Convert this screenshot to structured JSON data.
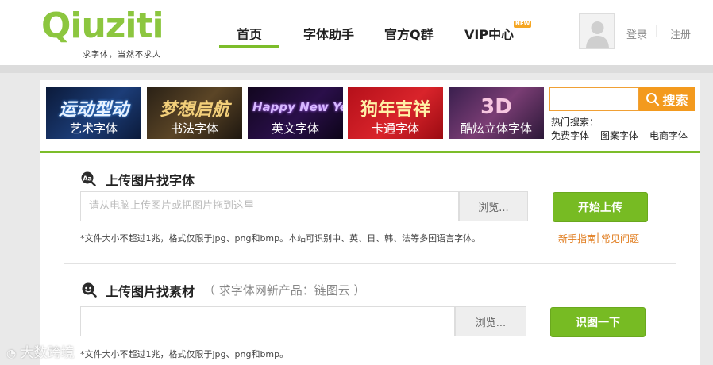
{
  "logo": {
    "text": "Qiuziti",
    "slogan": "求字体，当然不求人"
  },
  "nav": [
    {
      "label": "首页",
      "active": true
    },
    {
      "label": "字体助手"
    },
    {
      "label": "官方Q群"
    },
    {
      "label": "VIP中心",
      "badge": "NEW"
    }
  ],
  "auth": {
    "login": "登录",
    "separator": "|",
    "register": "注册"
  },
  "categories": [
    {
      "art": "运动型动",
      "label": "艺术字体"
    },
    {
      "art": "梦想启航",
      "label": "书法字体"
    },
    {
      "art": "Happy New Year",
      "label": "英文字体"
    },
    {
      "art": "狗年吉祥",
      "label": "卡通字体"
    },
    {
      "art": "3D",
      "label": "酷炫立体字体"
    }
  ],
  "search": {
    "value": "",
    "button_label": "搜索",
    "hot_title": "热门搜索：",
    "hot_links": [
      "免费字体",
      "图案字体",
      "电商字体"
    ]
  },
  "upload_font": {
    "title": "上传图片找字体",
    "placeholder": "请从电脑上传图片或把图片拖到这里",
    "browse_label": "浏览...",
    "button_label": "开始上传",
    "note": "*文件大小不超过1兆，格式仅限于jpg、png和bmp。本站可识别中、英、日、韩、法等多国语言字体。",
    "help_links": [
      "新手指南",
      "|",
      "常见问题"
    ]
  },
  "upload_material": {
    "title": "上传图片找素材",
    "subtitle": "（ 求字体网新产品：链图云 ）",
    "placeholder": "",
    "browse_label": "浏览...",
    "button_label": "识图一下",
    "note": "*文件大小不超过1兆，格式仅限于jpg、png和bmp。"
  },
  "watermark": "大数跨境",
  "colors": {
    "brand_green": "#7cbd2a",
    "search_orange": "#f39a1e",
    "help_orange": "#e07a1a"
  }
}
